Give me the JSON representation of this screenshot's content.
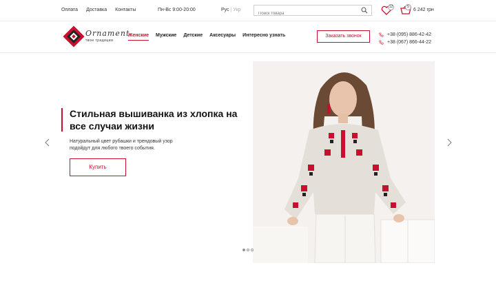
{
  "topbar": {
    "links": [
      "Оплата",
      "Доставка",
      "Контакты"
    ],
    "hours": "Пн-Вс 9:00-20:00",
    "lang_active": "Рус",
    "lang_inactive": "Укр",
    "search_placeholder": "Поиск товара",
    "wishlist_count": "12",
    "cart_count": "5",
    "cart_total": "6 242 грн"
  },
  "header": {
    "logo_name": "Ornament",
    "logo_tagline": "твои традиции",
    "nav": [
      "Женские",
      "Мужские",
      "Детские",
      "Аксесуары",
      "Интересно узнать"
    ],
    "callback_label": "Заказать звонок",
    "phones": [
      "+38 (095) 886-42-42",
      "+38 (067) 866-44-22"
    ]
  },
  "hero": {
    "title": "Стильная вышиванка из хлопка на все случаи жизни",
    "text": "Натуральный цвет рубашки и трендовый узор подойдут для любого твоего события.",
    "buy_label": "Купить"
  },
  "slider": {
    "slide_count": 3,
    "active_index": 0
  },
  "colors": {
    "accent": "#c8102e",
    "text": "#222222",
    "border": "#ececec"
  },
  "icons": [
    "search-icon",
    "heart-icon",
    "cart-icon",
    "phone-icon",
    "arrow-left-icon",
    "arrow-right-icon"
  ]
}
